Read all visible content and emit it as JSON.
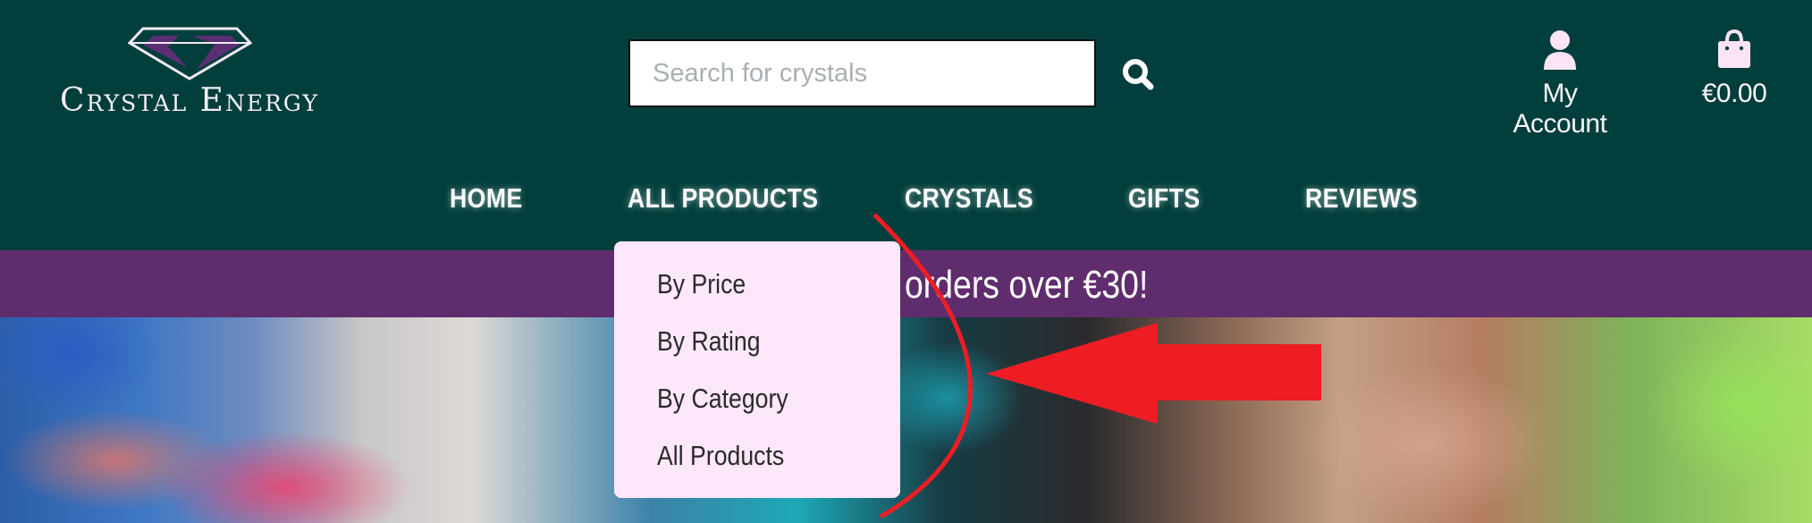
{
  "logo": {
    "text": "Crystal Energy"
  },
  "search": {
    "placeholder": "Search for crystals"
  },
  "header": {
    "account_label": "My Account",
    "cart_label": "€0.00"
  },
  "nav": {
    "items": [
      {
        "label": "HOME"
      },
      {
        "label": "ALL PRODUCTS"
      },
      {
        "label": "CRYSTALS"
      },
      {
        "label": "GIFTS"
      },
      {
        "label": "REVIEWS"
      }
    ]
  },
  "banner": {
    "text": "orders over €30!"
  },
  "dropdown": {
    "items": [
      {
        "label": "By Price"
      },
      {
        "label": "By Rating"
      },
      {
        "label": "By Category"
      },
      {
        "label": "All Products"
      }
    ]
  },
  "colors": {
    "header_bg": "#023f3c",
    "banner_bg": "#5f2d6d",
    "dropdown_bg": "#fde7fa",
    "annotation_red": "#ee1d23"
  }
}
